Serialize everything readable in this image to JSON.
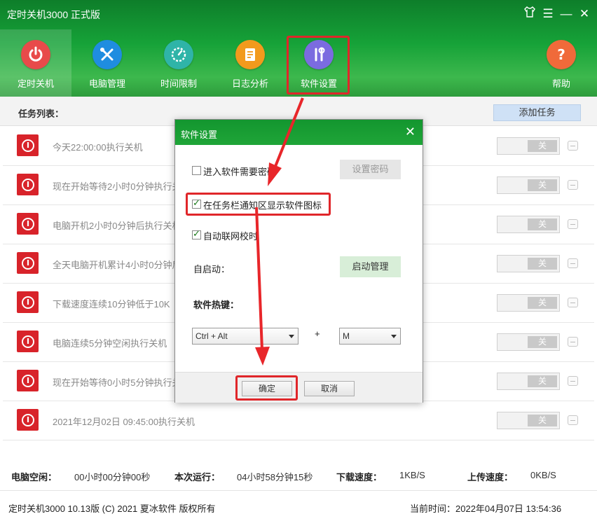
{
  "app": {
    "title": "定时关机3000 正式版"
  },
  "window_controls": [
    {
      "name": "skin-icon",
      "glyph": "👕"
    },
    {
      "name": "menu-icon",
      "glyph": "☰"
    },
    {
      "name": "minimize-icon",
      "glyph": "—"
    },
    {
      "name": "close-icon",
      "glyph": "✕"
    }
  ],
  "nav": [
    {
      "label": "定时关机",
      "icon": "power-icon",
      "color": "#e84a4a",
      "active": true
    },
    {
      "label": "电脑管理",
      "icon": "tools-icon",
      "color": "#1f8de0"
    },
    {
      "label": "时间限制",
      "icon": "timer-icon",
      "color": "#2fb4a8"
    },
    {
      "label": "日志分析",
      "icon": "log-icon",
      "color": "#f29a1d"
    },
    {
      "label": "软件设置",
      "icon": "settings-tools-icon",
      "color": "#7b6be0"
    },
    {
      "label": "帮助",
      "icon": "help-icon",
      "color": "#f06a3a"
    }
  ],
  "task_list": {
    "label": "任务列表：",
    "add_button": "添加任务",
    "toggle_off": "关",
    "tasks": [
      "今天22:00:00执行关机",
      "现在开始等待2小时0分钟执行关",
      "电脑开机2小时0分钟后执行关机",
      "全天电脑开机累计4小时0分钟后",
      "下载速度连续10分钟低于10K",
      "电脑连续5分钟空闲执行关机",
      "现在开始等待0小时5分钟执行关",
      "2021年12月02日 09:45:00执行关机"
    ]
  },
  "status": {
    "idle_label": "电脑空闲：",
    "idle_value": "00小时00分钟00秒",
    "run_label": "本次运行：",
    "run_value": "04小时58分钟15秒",
    "down_label": "下载速度：",
    "down_value": "1KB/S",
    "up_label": "上传速度：",
    "up_value": "0KB/S"
  },
  "footer": {
    "copyright": "定时关机3000 10.13版 (C) 2021  夏冰软件 版权所有",
    "time": "当前时间：2022年04月07日 13:54:36"
  },
  "dialog": {
    "title": "软件设置",
    "close": "✕",
    "password_check": "进入软件需要密码",
    "password_checked": false,
    "set_password": "设置密码",
    "tray_check": "在任务栏通知区显示软件图标",
    "tray_checked": true,
    "sync_check": "自动联网校时",
    "sync_checked": true,
    "autostart_label": "自启动：",
    "autostart_button": "启动管理",
    "hotkey_label": "软件热键：",
    "hotkey_mod": "Ctrl + Alt",
    "hotkey_plus": "+",
    "hotkey_key": "M",
    "ok": "确定",
    "cancel": "取消"
  },
  "colors": {
    "header_green": "#16a238",
    "annotation_red": "#e0262a",
    "task_icon_red": "#d8232a"
  }
}
